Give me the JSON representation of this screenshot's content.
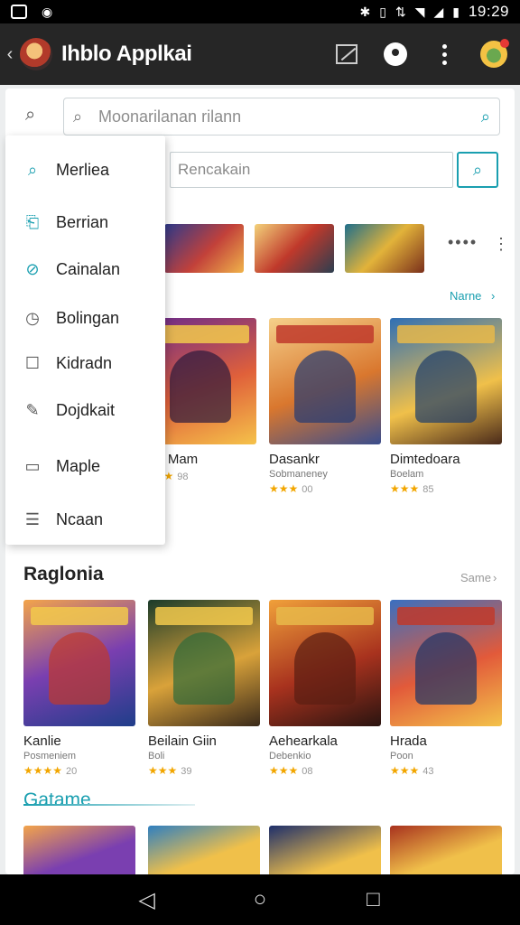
{
  "status_bar": {
    "time": "19:29"
  },
  "app_bar": {
    "title": "Ihblo Applkai"
  },
  "search": {
    "placeholder": "Moonarilanan rilann",
    "secondary_placeholder": "Rencakain"
  },
  "drawer": {
    "items": [
      {
        "label": "Merliea",
        "icon": "search-icon"
      },
      {
        "label": "Berrian",
        "icon": "bookmark-icon"
      },
      {
        "label": "Cainalan",
        "icon": "edit-circle-icon"
      },
      {
        "label": "Bolingan",
        "icon": "clock-icon"
      },
      {
        "label": "Kidradn",
        "icon": "square-icon"
      },
      {
        "label": "Dojdkait",
        "icon": "pin-icon"
      },
      {
        "label": "Maple",
        "icon": "message-icon"
      },
      {
        "label": "Ncaan",
        "icon": "list-icon"
      }
    ]
  },
  "section1": {
    "see_more": "Narne",
    "cards": [
      {
        "name": "are Mam",
        "subtitle": "",
        "stars": "★★★",
        "rating": "98"
      },
      {
        "name": "Dasankr",
        "subtitle": "Sobmaneney",
        "stars": "★★★",
        "rating": "00"
      },
      {
        "name": "Dimtedoara",
        "subtitle": "Boelam",
        "stars": "★★★",
        "rating": "85"
      }
    ]
  },
  "section2": {
    "title": "Raglonia",
    "see_more": "Same",
    "cards": [
      {
        "name": "Kanlie",
        "subtitle": "Posmeniem",
        "stars": "★★★★",
        "rating": "20"
      },
      {
        "name": "Beilain Giin",
        "subtitle": "Boli",
        "stars": "★★★",
        "rating": "39"
      },
      {
        "name": "Aehearkala",
        "subtitle": "Debenkio",
        "stars": "★★★",
        "rating": "08"
      },
      {
        "name": "Hrada",
        "subtitle": "Poon",
        "stars": "★★★",
        "rating": "43"
      }
    ]
  },
  "section3": {
    "title": "Gatame"
  },
  "colors": {
    "accent": "#1a9fb0",
    "app_bar": "#262626",
    "star": "#f2a600"
  }
}
